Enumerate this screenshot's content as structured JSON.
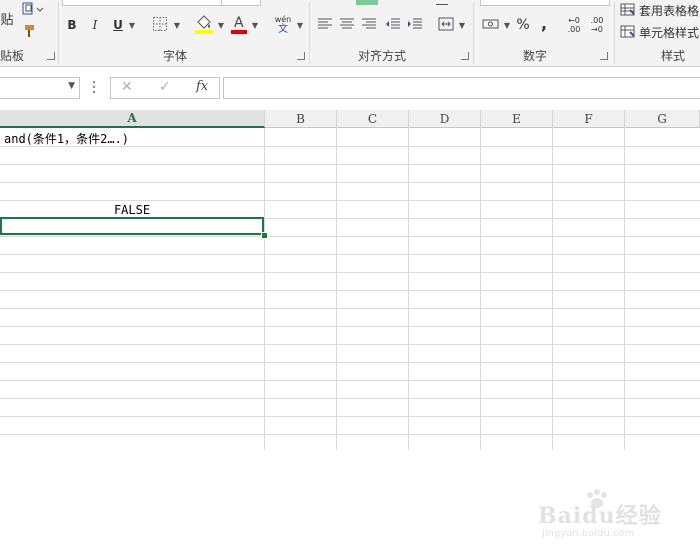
{
  "ribbon": {
    "clipboard": {
      "paste_label": "贴",
      "group_label": "贴板"
    },
    "font": {
      "bold": "B",
      "italic": "I",
      "underline": "U",
      "wen_top": "wén",
      "wen_bottom": "文",
      "group_label": "字体",
      "fill_color": "#ffff00",
      "font_color": "#e00000"
    },
    "alignment": {
      "group_label": "对齐方式"
    },
    "number": {
      "percent": "%",
      "comma": ",",
      "inc_decimal_top": "←0",
      "inc_decimal_bottom": ".00",
      "dec_decimal_top": ".00",
      "dec_decimal_bottom": "→0",
      "group_label": "数字"
    },
    "styles": {
      "table_format": "套用表格格",
      "cell_style": "单元格样式",
      "group_label": "样式"
    }
  },
  "formula_bar": {
    "cancel": "✕",
    "enter": "✓",
    "fx": "fx",
    "formula": ""
  },
  "sheet": {
    "columns": [
      "A",
      "B",
      "C",
      "D",
      "E",
      "F",
      "G"
    ],
    "selected_column": "A",
    "cells": {
      "A1": "and(条件1，条件2….)",
      "A5": "FALSE"
    },
    "accent_color": "#217346"
  },
  "watermark": {
    "text": "Baidu经验",
    "url": "jingyan.baidu.com"
  }
}
